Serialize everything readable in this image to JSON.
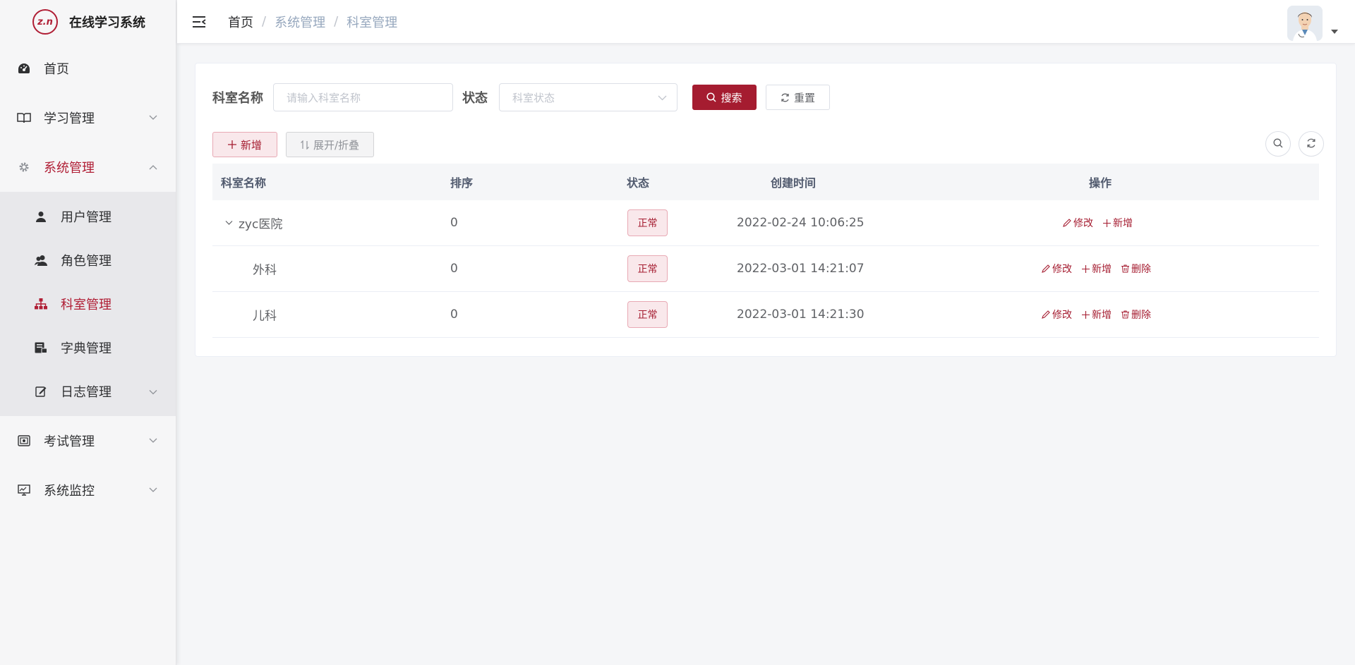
{
  "app": {
    "title": "在线学习系统",
    "logo_text": "z.n"
  },
  "sidebar": {
    "items": [
      {
        "label": "首页"
      },
      {
        "label": "学习管理"
      },
      {
        "label": "系统管理"
      },
      {
        "label": "考试管理"
      },
      {
        "label": "系统监控"
      }
    ],
    "system_sub": [
      {
        "label": "用户管理"
      },
      {
        "label": "角色管理"
      },
      {
        "label": "科室管理"
      },
      {
        "label": "字典管理"
      },
      {
        "label": "日志管理"
      }
    ]
  },
  "breadcrumb": {
    "home": "首页",
    "sep": "/",
    "section": "系统管理",
    "page": "科室管理"
  },
  "search": {
    "dept_label": "科室名称",
    "dept_placeholder": "请输入科室名称",
    "status_label": "状态",
    "status_placeholder": "科室状态",
    "search_button": "搜索",
    "reset_button": "重置"
  },
  "toolbar": {
    "add_button": "新增",
    "toggle_button": "展开/折叠"
  },
  "table": {
    "columns": [
      "科室名称",
      "排序",
      "状态",
      "创建时间",
      "操作"
    ],
    "rows": [
      {
        "name": "zyc医院",
        "order": "0",
        "status": "正常",
        "created": "2022-02-24 10:06:25"
      },
      {
        "name": "外科",
        "order": "0",
        "status": "正常",
        "created": "2022-03-01 14:21:07"
      },
      {
        "name": "儿科",
        "order": "0",
        "status": "正常",
        "created": "2022-03-01 14:21:30"
      }
    ],
    "actions": {
      "edit": "修改",
      "add": "新增",
      "delete": "删除"
    }
  },
  "colors": {
    "accent": "#a51c30",
    "tag_bg": "#f9e8eb",
    "sidebar_bg": "#f6f6f7",
    "submenu_bg": "#e8e8eb"
  },
  "icons": [
    "dashboard-icon",
    "book-icon",
    "gear-icon",
    "user-icon",
    "users-icon",
    "org-tree-icon",
    "dictionary-icon",
    "edit-log-icon",
    "exam-icon",
    "monitor-icon",
    "menu-fold-icon",
    "search-icon",
    "refresh-icon",
    "plus-icon",
    "sort-icon",
    "edit-icon",
    "delete-icon",
    "chevron-down-icon",
    "chevron-up-icon"
  ]
}
